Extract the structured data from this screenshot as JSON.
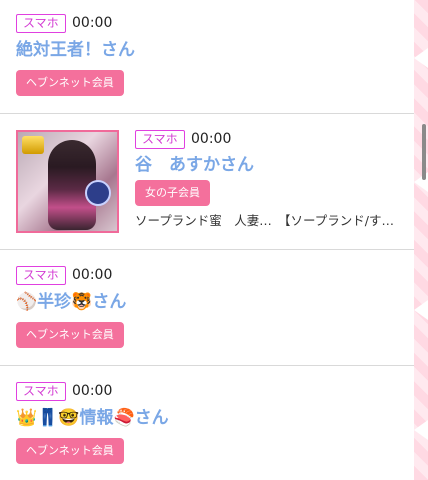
{
  "items": [
    {
      "device": "スマホ",
      "time": "00:00",
      "name": "絶対王者！さん",
      "badge": "ヘブンネット会員"
    },
    {
      "device": "スマホ",
      "time": "00:00",
      "name": "谷　あすかさん",
      "badge": "女の子会員",
      "description": "ソープランド蜜　人妻…　【ソープランド/す…"
    },
    {
      "device": "スマホ",
      "time": "00:00",
      "name": "⚾半珍🐯さん",
      "badge": "ヘブンネット会員"
    },
    {
      "device": "スマホ",
      "time": "00:00",
      "name": "👑👖🤓情報🍣さん",
      "badge": "ヘブンネット会員"
    }
  ]
}
